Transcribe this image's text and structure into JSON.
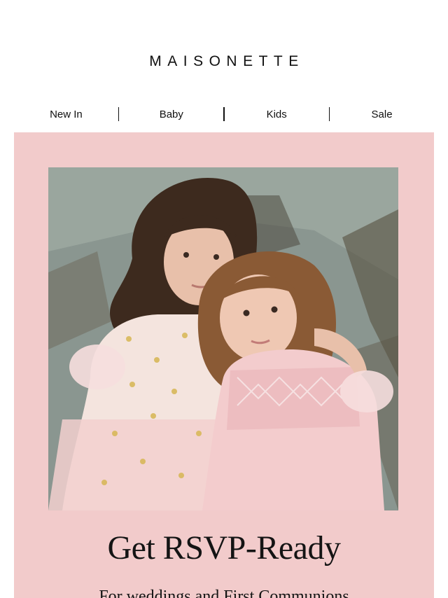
{
  "brand": {
    "logo_text": "MAISONETTE"
  },
  "nav": {
    "items": [
      {
        "label": "New In"
      },
      {
        "label": "Baby"
      },
      {
        "label": "Kids"
      },
      {
        "label": "Sale"
      }
    ]
  },
  "hero": {
    "image_alt": "Two girls in pink dresses embracing",
    "headline": "Get RSVP-Ready",
    "subline": "For weddings and First Communions",
    "colors": {
      "panel": "#f2cbcb",
      "text": "#141414"
    }
  }
}
